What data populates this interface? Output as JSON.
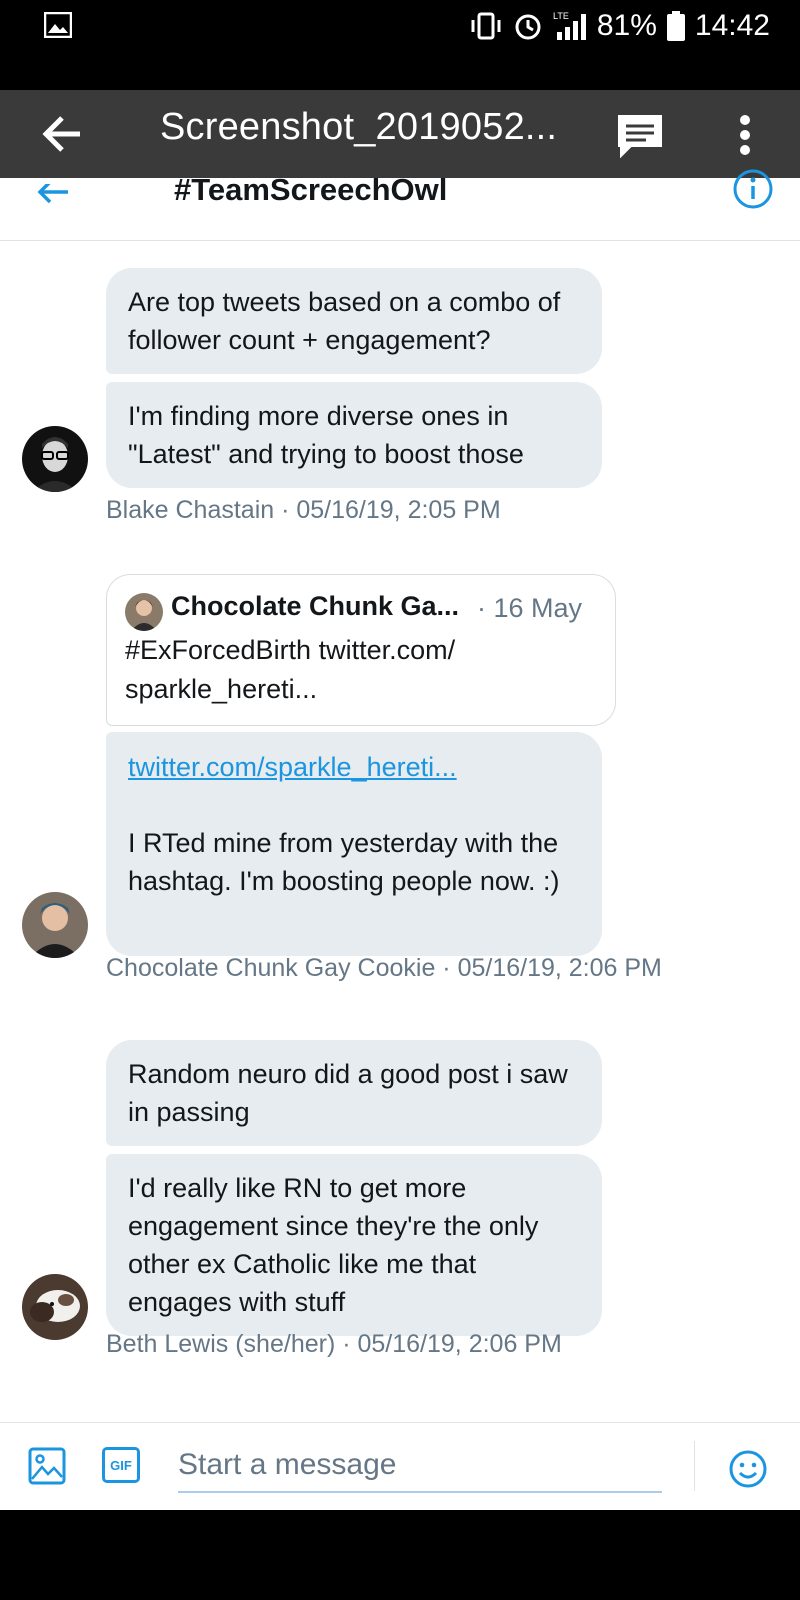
{
  "status_bar": {
    "battery": "81%",
    "time": "14:42",
    "network": "LTE"
  },
  "viewer": {
    "title": "Screenshot_2019052..."
  },
  "dm": {
    "title": "#TeamScreechOwl",
    "messages": [
      {
        "text": "Are top tweets based on a combo of follower count + engagement?"
      },
      {
        "text": "I'm finding more diverse ones in \"Latest\" and trying to boost those"
      },
      {
        "link": "twitter.com/sparkle_hereti...",
        "text": "I RTed mine from yesterday with the hashtag. I'm boosting people now. :)"
      },
      {
        "text": "Random neuro did a good post i saw in passing"
      },
      {
        "text": "I'd really like RN to get more engagement since they're the only other ex Catholic like me that engages with stuff"
      }
    ],
    "meta": [
      "Blake Chastain · 05/16/19, 2:05 PM",
      "Chocolate Chunk Gay Cookie · 05/16/19, 2:06 PM",
      "Beth Lewis (she/her) · 05/16/19, 2:06 PM"
    ],
    "quote": {
      "name": "Chocolate Chunk Ga...",
      "date": "· 16 May",
      "text": "#ExForcedBirth twitter.com/ sparkle_hereti..."
    }
  },
  "composer": {
    "placeholder": "Start a message",
    "gif_label": "GIF"
  },
  "colors": {
    "accent": "#1b95e0",
    "bubble": "#e6ecf0",
    "meta": "#657786",
    "viewer_bar": "#3a3a3a"
  }
}
